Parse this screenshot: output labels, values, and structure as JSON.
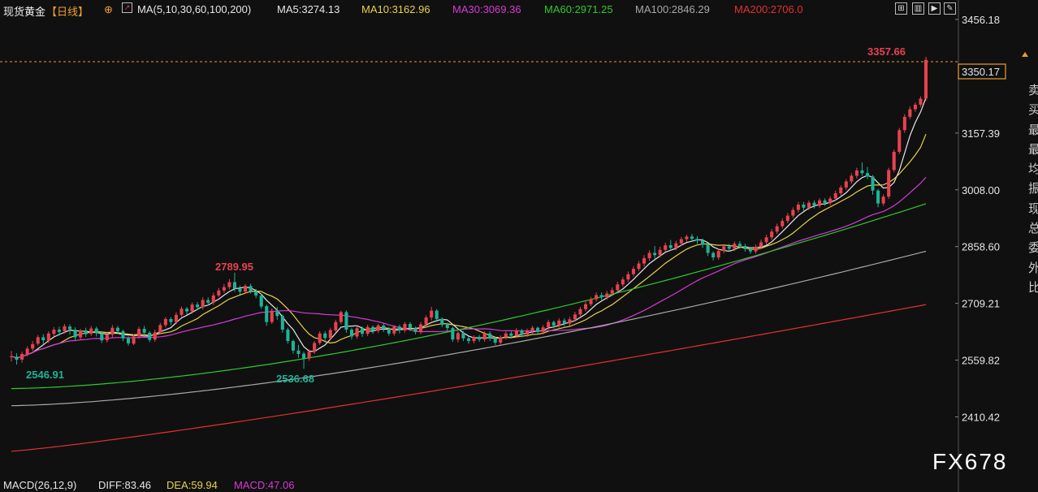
{
  "header": {
    "instrument": "现货黄金",
    "period": "【日线】",
    "add_icon": "⊕",
    "ma_icon": "chart-icon",
    "ma_params": "MA(5,10,30,60,100,200)",
    "ma_values": [
      {
        "label": "MA5:3274.13",
        "color": "#e6e6e6"
      },
      {
        "label": "MA10:3162.96",
        "color": "#e8d24a"
      },
      {
        "label": "MA30:3069.36",
        "color": "#d63ad6"
      },
      {
        "label": "MA60:2971.25",
        "color": "#2ec92e"
      },
      {
        "label": "MA100:2846.29",
        "color": "#a8a8a8"
      },
      {
        "label": "MA200:2706.0",
        "color": "#e53030"
      }
    ],
    "tool_icons": [
      "expand-icon",
      "panel-icon",
      "play-icon",
      "edit-icon"
    ]
  },
  "price_axis": {
    "ticks": [
      "3456.18",
      "3157.39",
      "3008.00",
      "2858.60",
      "2709.21",
      "2559.82",
      "2410.42"
    ],
    "current_price": "3350.17"
  },
  "annotations": {
    "high_label": "3357.66",
    "peak_label": "2789.95",
    "low_left_label": "2546.91",
    "low_mid_label": "2536.68"
  },
  "macd": {
    "label": "MACD(26,12,9)",
    "diff": "DIFF:83.46",
    "dea": "DEA:59.94",
    "macd": "MACD:47.06"
  },
  "watermark": "FX678",
  "right_column": [
    "卖",
    "买",
    "最",
    "最",
    "均",
    "振",
    "现",
    "总",
    "委",
    "外",
    "比"
  ],
  "colors": {
    "up": "#e8424f",
    "down": "#1db498",
    "background": "#101010",
    "dash_line": "#e89c2a",
    "price_box": "#f0a030",
    "low_label": "#1db498",
    "high_label": "#e8424f",
    "macd_diff": "#e6e6e6",
    "macd_dea": "#e8d24a",
    "macd_macd": "#d63ad6"
  },
  "chart_data": {
    "type": "candlestick",
    "period": "daily",
    "instrument": "现货黄金",
    "ylim": [
      2380,
      3480
    ],
    "candles": [
      [
        2570,
        2570,
        2556,
        2584
      ],
      [
        2569,
        2561,
        2548,
        2578
      ],
      [
        2561,
        2576,
        2553,
        2582
      ],
      [
        2575,
        2590,
        2570,
        2596
      ],
      [
        2590,
        2602,
        2584,
        2610
      ],
      [
        2603,
        2620,
        2598,
        2626
      ],
      [
        2620,
        2612,
        2601,
        2628
      ],
      [
        2611,
        2630,
        2605,
        2636
      ],
      [
        2629,
        2640,
        2622,
        2647
      ],
      [
        2640,
        2634,
        2624,
        2648
      ],
      [
        2636,
        2649,
        2630,
        2655
      ],
      [
        2648,
        2641,
        2627,
        2654
      ],
      [
        2640,
        2620,
        2612,
        2646
      ],
      [
        2620,
        2638,
        2614,
        2642
      ],
      [
        2638,
        2628,
        2621,
        2645
      ],
      [
        2629,
        2643,
        2624,
        2650
      ],
      [
        2643,
        2631,
        2622,
        2648
      ],
      [
        2630,
        2612,
        2605,
        2636
      ],
      [
        2612,
        2627,
        2606,
        2632
      ],
      [
        2627,
        2645,
        2620,
        2652
      ],
      [
        2645,
        2636,
        2629,
        2650
      ],
      [
        2636,
        2617,
        2610,
        2640
      ],
      [
        2617,
        2604,
        2598,
        2622
      ],
      [
        2603,
        2622,
        2599,
        2628
      ],
      [
        2622,
        2642,
        2616,
        2648
      ],
      [
        2642,
        2632,
        2624,
        2650
      ],
      [
        2632,
        2613,
        2607,
        2636
      ],
      [
        2614,
        2633,
        2608,
        2640
      ],
      [
        2633,
        2652,
        2628,
        2658
      ],
      [
        2652,
        2668,
        2646,
        2673
      ],
      [
        2668,
        2660,
        2652,
        2673
      ],
      [
        2660,
        2679,
        2654,
        2686
      ],
      [
        2679,
        2695,
        2674,
        2701
      ],
      [
        2695,
        2688,
        2680,
        2700
      ],
      [
        2688,
        2706,
        2682,
        2712
      ],
      [
        2706,
        2699,
        2691,
        2713
      ],
      [
        2699,
        2718,
        2693,
        2725
      ],
      [
        2718,
        2711,
        2703,
        2725
      ],
      [
        2711,
        2730,
        2705,
        2737
      ],
      [
        2730,
        2743,
        2726,
        2750
      ],
      [
        2743,
        2752,
        2737,
        2760
      ],
      [
        2752,
        2765,
        2746,
        2773
      ],
      [
        2765,
        2748,
        2740,
        2790
      ],
      [
        2748,
        2740,
        2732,
        2756
      ],
      [
        2740,
        2755,
        2735,
        2760
      ],
      [
        2755,
        2741,
        2735,
        2761
      ],
      [
        2741,
        2730,
        2723,
        2747
      ],
      [
        2730,
        2701,
        2695,
        2734
      ],
      [
        2702,
        2660,
        2650,
        2706
      ],
      [
        2660,
        2690,
        2655,
        2696
      ],
      [
        2690,
        2676,
        2666,
        2700
      ],
      [
        2676,
        2640,
        2632,
        2680
      ],
      [
        2640,
        2610,
        2603,
        2645
      ],
      [
        2610,
        2585,
        2577,
        2614
      ],
      [
        2585,
        2576,
        2566,
        2600
      ],
      [
        2577,
        2564,
        2537,
        2582
      ],
      [
        2564,
        2582,
        2558,
        2588
      ],
      [
        2582,
        2605,
        2576,
        2610
      ],
      [
        2605,
        2630,
        2600,
        2636
      ],
      [
        2630,
        2618,
        2610,
        2636
      ],
      [
        2618,
        2639,
        2612,
        2645
      ],
      [
        2638,
        2660,
        2632,
        2666
      ],
      [
        2660,
        2686,
        2654,
        2690
      ],
      [
        2686,
        2640,
        2632,
        2691
      ],
      [
        2640,
        2622,
        2614,
        2645
      ],
      [
        2622,
        2644,
        2616,
        2650
      ],
      [
        2644,
        2629,
        2621,
        2648
      ],
      [
        2629,
        2647,
        2623,
        2653
      ],
      [
        2647,
        2637,
        2629,
        2651
      ],
      [
        2637,
        2651,
        2631,
        2656
      ],
      [
        2651,
        2642,
        2634,
        2656
      ],
      [
        2642,
        2630,
        2624,
        2647
      ],
      [
        2630,
        2648,
        2624,
        2652
      ],
      [
        2648,
        2638,
        2630,
        2653
      ],
      [
        2638,
        2655,
        2632,
        2660
      ],
      [
        2655,
        2644,
        2636,
        2660
      ],
      [
        2644,
        2634,
        2628,
        2648
      ],
      [
        2634,
        2654,
        2628,
        2660
      ],
      [
        2654,
        2672,
        2648,
        2678
      ],
      [
        2672,
        2690,
        2664,
        2700
      ],
      [
        2690,
        2668,
        2660,
        2694
      ],
      [
        2668,
        2653,
        2647,
        2672
      ],
      [
        2653,
        2644,
        2637,
        2658
      ],
      [
        2644,
        2614,
        2608,
        2648
      ],
      [
        2614,
        2631,
        2606,
        2636
      ],
      [
        2631,
        2617,
        2610,
        2636
      ],
      [
        2617,
        2610,
        2603,
        2622
      ],
      [
        2610,
        2621,
        2604,
        2625
      ],
      [
        2621,
        2614,
        2608,
        2626
      ],
      [
        2614,
        2630,
        2608,
        2636
      ],
      [
        2630,
        2618,
        2610,
        2636
      ],
      [
        2618,
        2606,
        2600,
        2622
      ],
      [
        2606,
        2620,
        2600,
        2625
      ],
      [
        2620,
        2630,
        2614,
        2635
      ],
      [
        2630,
        2624,
        2617,
        2636
      ],
      [
        2624,
        2638,
        2618,
        2644
      ],
      [
        2638,
        2627,
        2620,
        2642
      ],
      [
        2627,
        2637,
        2621,
        2643
      ],
      [
        2637,
        2645,
        2630,
        2650
      ],
      [
        2645,
        2634,
        2628,
        2648
      ],
      [
        2634,
        2646,
        2628,
        2652
      ],
      [
        2646,
        2660,
        2640,
        2666
      ],
      [
        2660,
        2651,
        2643,
        2664
      ],
      [
        2651,
        2664,
        2645,
        2670
      ],
      [
        2664,
        2656,
        2649,
        2670
      ],
      [
        2656,
        2667,
        2650,
        2674
      ],
      [
        2667,
        2680,
        2662,
        2687
      ],
      [
        2680,
        2694,
        2674,
        2700
      ],
      [
        2694,
        2707,
        2688,
        2714
      ],
      [
        2707,
        2720,
        2702,
        2726
      ],
      [
        2720,
        2731,
        2714,
        2738
      ],
      [
        2731,
        2725,
        2718,
        2738
      ],
      [
        2725,
        2735,
        2719,
        2742
      ],
      [
        2735,
        2744,
        2729,
        2751
      ],
      [
        2744,
        2759,
        2738,
        2766
      ],
      [
        2759,
        2772,
        2753,
        2779
      ],
      [
        2772,
        2786,
        2765,
        2793
      ],
      [
        2786,
        2800,
        2780,
        2807
      ],
      [
        2800,
        2814,
        2794,
        2821
      ],
      [
        2814,
        2828,
        2806,
        2836
      ],
      [
        2828,
        2842,
        2821,
        2849
      ],
      [
        2842,
        2836,
        2827,
        2860
      ],
      [
        2836,
        2850,
        2830,
        2858
      ],
      [
        2850,
        2862,
        2844,
        2869
      ],
      [
        2862,
        2855,
        2848,
        2876
      ],
      [
        2855,
        2867,
        2849,
        2874
      ],
      [
        2867,
        2878,
        2861,
        2884
      ],
      [
        2878,
        2885,
        2871,
        2890
      ],
      [
        2885,
        2879,
        2871,
        2892
      ],
      [
        2879,
        2874,
        2866,
        2886
      ],
      [
        2874,
        2864,
        2855,
        2880
      ],
      [
        2864,
        2842,
        2834,
        2868
      ],
      [
        2842,
        2830,
        2822,
        2846
      ],
      [
        2830,
        2847,
        2824,
        2852
      ],
      [
        2847,
        2859,
        2841,
        2865
      ],
      [
        2859,
        2853,
        2846,
        2866
      ],
      [
        2853,
        2866,
        2847,
        2872
      ],
      [
        2866,
        2860,
        2853,
        2873
      ],
      [
        2860,
        2852,
        2845,
        2866
      ],
      [
        2852,
        2846,
        2840,
        2858
      ],
      [
        2846,
        2858,
        2840,
        2864
      ],
      [
        2858,
        2870,
        2852,
        2877
      ],
      [
        2870,
        2883,
        2864,
        2890
      ],
      [
        2883,
        2898,
        2876,
        2905
      ],
      [
        2898,
        2912,
        2892,
        2919
      ],
      [
        2912,
        2926,
        2906,
        2933
      ],
      [
        2926,
        2940,
        2920,
        2947
      ],
      [
        2940,
        2955,
        2934,
        2962
      ],
      [
        2955,
        2969,
        2948,
        2976
      ],
      [
        2969,
        2961,
        2953,
        2976
      ],
      [
        2961,
        2974,
        2955,
        2980
      ],
      [
        2974,
        2966,
        2959,
        2980
      ],
      [
        2966,
        2980,
        2960,
        2986
      ],
      [
        2980,
        2973,
        2966,
        2986
      ],
      [
        2973,
        2985,
        2967,
        2991
      ],
      [
        2985,
        2999,
        2979,
        3006
      ],
      [
        2999,
        3014,
        2993,
        3020
      ],
      [
        3014,
        3030,
        3008,
        3036
      ],
      [
        3030,
        3045,
        3024,
        3052
      ],
      [
        3045,
        3059,
        3038,
        3066
      ],
      [
        3059,
        3052,
        3045,
        3080
      ],
      [
        3052,
        3043,
        3036,
        3068
      ],
      [
        3043,
        3006,
        2995,
        3047
      ],
      [
        3006,
        2972,
        2962,
        3010
      ],
      [
        2972,
        2990,
        2966,
        2996
      ],
      [
        2990,
        3060,
        2984,
        3066
      ],
      [
        3060,
        3108,
        3054,
        3114
      ],
      [
        3108,
        3165,
        3102,
        3171
      ],
      [
        3165,
        3200,
        3158,
        3207
      ],
      [
        3200,
        3220,
        3194,
        3228
      ],
      [
        3220,
        3232,
        3213,
        3238
      ],
      [
        3232,
        3248,
        3226,
        3254
      ],
      [
        3248,
        3350,
        3242,
        3358
      ]
    ]
  }
}
